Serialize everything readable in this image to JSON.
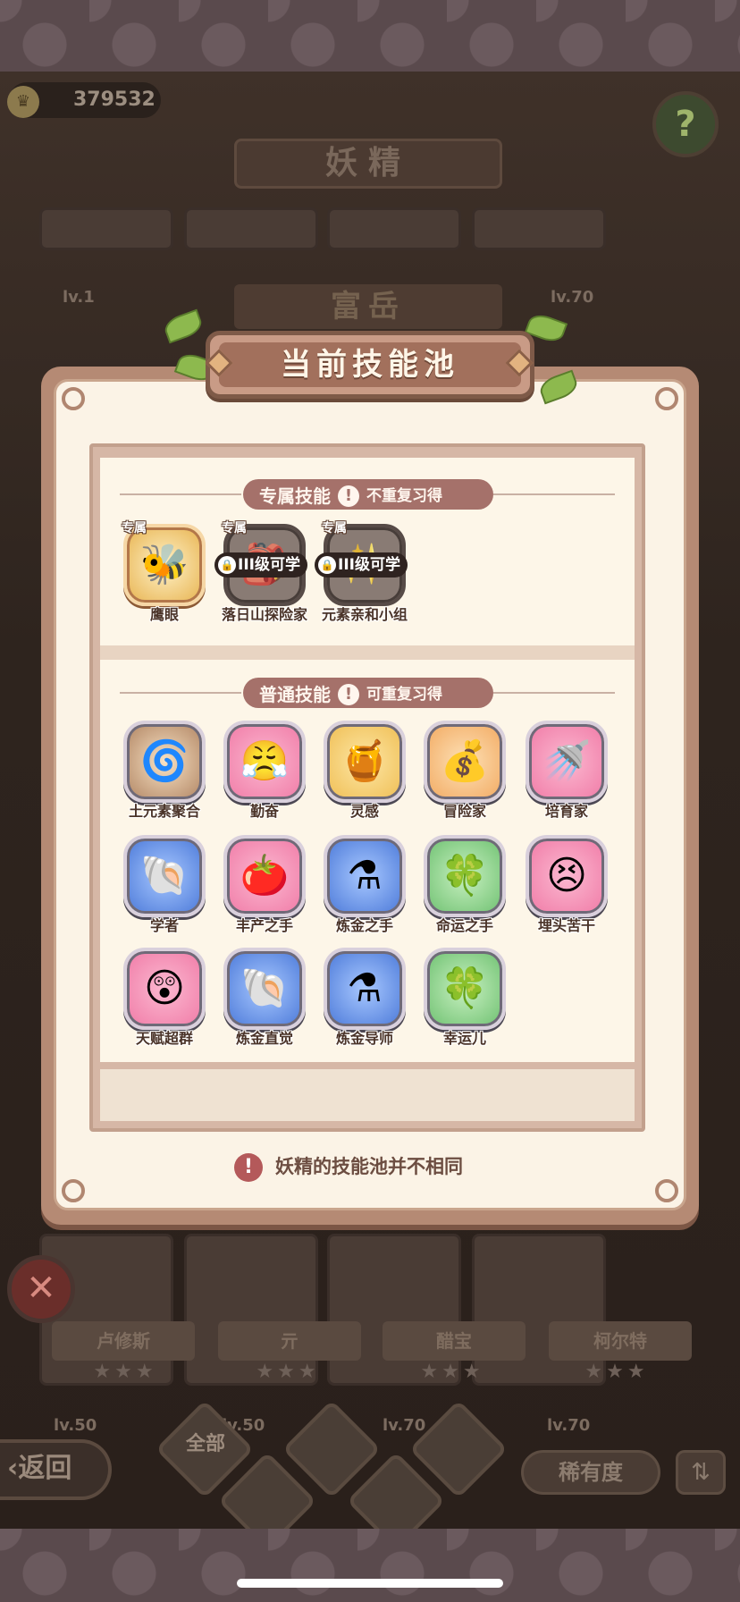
{
  "top_bar": {
    "coins": "379532",
    "coin_icon": "crown-coin-icon",
    "help_icon": "question-leaf-icon"
  },
  "background": {
    "title": "妖精",
    "subtitle": "富岳",
    "level_left": "lv.1",
    "level_right": "lv.70",
    "cards": [
      {
        "name": "卢修斯",
        "stars": "★★★"
      },
      {
        "name": "亓",
        "stars": "★★★"
      },
      {
        "name": "醋宝",
        "stars": "★★★"
      },
      {
        "name": "柯尔特",
        "stars": "★★★"
      }
    ],
    "bottom_levels": [
      "lv.50",
      "lv.50",
      "lv.70",
      "lv.70"
    ]
  },
  "dialog": {
    "title": "当前技能池",
    "exclusive_section": {
      "label": "专属技能",
      "note": "不重复习得",
      "skills": [
        {
          "tag": "专属",
          "name": "鹰眼",
          "icon": "bee-icon",
          "glyph": "🐝",
          "lock": ""
        },
        {
          "tag": "专属",
          "name": "落日山探险家",
          "icon": "explorer-icon",
          "glyph": "🎒",
          "lock": "III级可学"
        },
        {
          "tag": "专属",
          "name": "元素亲和小组",
          "icon": "element-group-icon",
          "glyph": "✨",
          "lock": "III级可学"
        }
      ]
    },
    "common_section": {
      "label": "普通技能",
      "note": "可重复习得",
      "skills": [
        {
          "name": "土元素聚合",
          "icon": "swirl-icon",
          "glyph": "🌀",
          "color": "earth"
        },
        {
          "name": "勤奋",
          "icon": "pink-face-icon",
          "glyph": "😤",
          "color": "pink"
        },
        {
          "name": "灵感",
          "icon": "gold-pot-icon",
          "glyph": "🍯",
          "color": "gold"
        },
        {
          "name": "冒险家",
          "icon": "treasure-arrow-icon",
          "glyph": "💰",
          "color": "orange"
        },
        {
          "name": "培育家",
          "icon": "watering-can-icon",
          "glyph": "🚿",
          "color": "pink"
        },
        {
          "name": "学者",
          "icon": "shell-icon",
          "glyph": "🐚",
          "color": "blue"
        },
        {
          "name": "丰产之手",
          "icon": "tomato-icon",
          "glyph": "🍅",
          "color": "pink"
        },
        {
          "name": "炼金之手",
          "icon": "cauldron-icon",
          "glyph": "⚗",
          "color": "blue"
        },
        {
          "name": "命运之手",
          "icon": "clover-icon",
          "glyph": "🍀",
          "color": "green"
        },
        {
          "name": "埋头苦干",
          "icon": "pink-face-icon",
          "glyph": "😣",
          "color": "pink"
        },
        {
          "name": "天赋超群",
          "icon": "surprised-face-icon",
          "glyph": "😲",
          "color": "pink"
        },
        {
          "name": "炼金直觉",
          "icon": "shell-icon",
          "glyph": "🐚",
          "color": "blue"
        },
        {
          "name": "炼金导师",
          "icon": "cauldron-icon",
          "glyph": "⚗",
          "color": "blue"
        },
        {
          "name": "幸运儿",
          "icon": "clover-icon",
          "glyph": "🍀",
          "color": "green"
        }
      ]
    },
    "footer_note": "妖精的技能池并不相同"
  },
  "bottom_nav": {
    "back": "返回",
    "filter_all": "全部",
    "rarity": "稀有度",
    "sort_icon": "sort-icon"
  }
}
